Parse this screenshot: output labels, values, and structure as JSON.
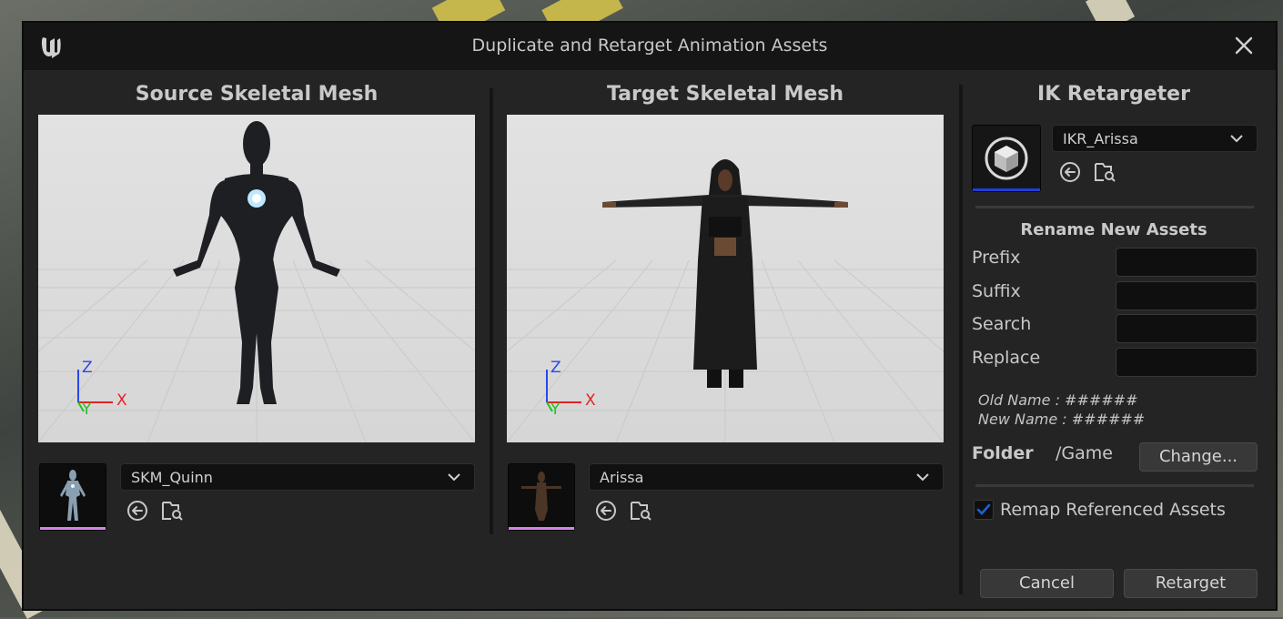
{
  "window": {
    "title": "Duplicate and Retarget Animation Assets"
  },
  "source": {
    "heading": "Source Skeletal Mesh",
    "mesh": "SKM_Quinn",
    "axes": {
      "z": "Z",
      "y": "Y",
      "x": "X"
    }
  },
  "target": {
    "heading": "Target Skeletal Mesh",
    "mesh": "Arissa",
    "axes": {
      "z": "Z",
      "y": "Y",
      "x": "X"
    }
  },
  "retargeter": {
    "heading": "IK Retargeter",
    "asset": "IKR_Arissa"
  },
  "rename": {
    "heading": "Rename New Assets",
    "fields": [
      {
        "label": "Prefix",
        "value": ""
      },
      {
        "label": "Suffix",
        "value": ""
      },
      {
        "label": "Search",
        "value": ""
      },
      {
        "label": "Replace",
        "value": ""
      }
    ],
    "old_name": "Old Name : ######",
    "new_name": "New Name : ######"
  },
  "folder": {
    "label": "Folder",
    "path": "/Game",
    "change_label": "Change..."
  },
  "remap": {
    "label": "Remap Referenced Assets",
    "checked": true
  },
  "actions": {
    "cancel": "Cancel",
    "retarget": "Retarget"
  },
  "colors": {
    "axis_x": "#e32222",
    "axis_y": "#22c322",
    "axis_z": "#2a48e8",
    "accent": "#1e5fd6",
    "thumb_bar": "#d385e6"
  }
}
